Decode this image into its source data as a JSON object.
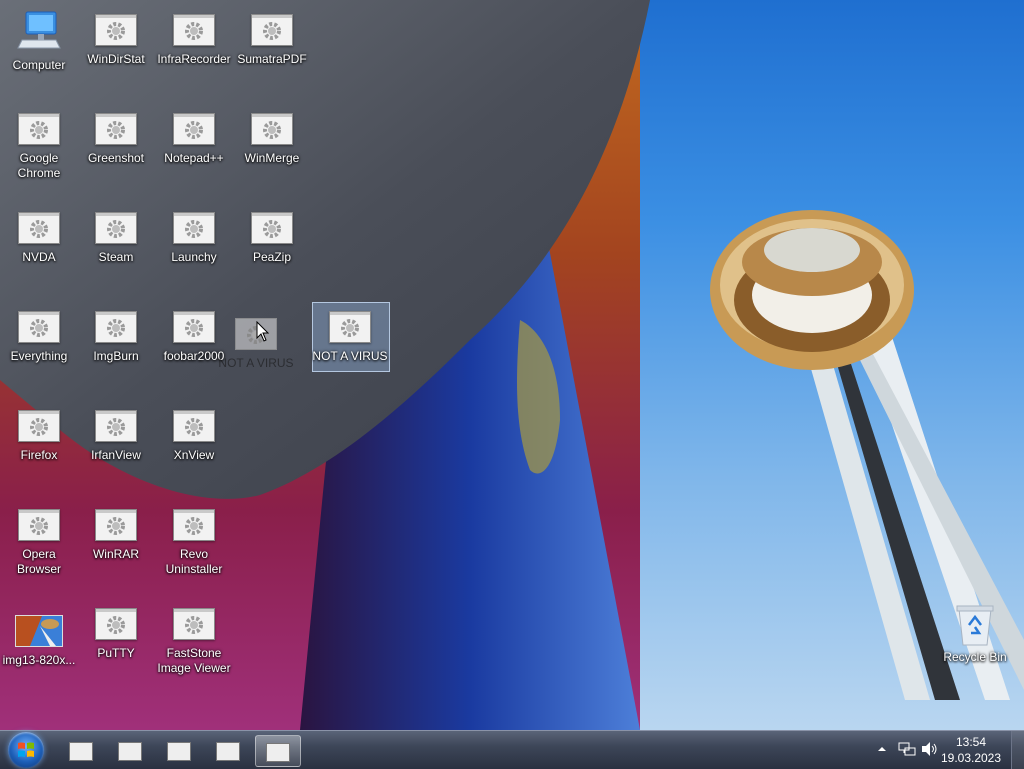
{
  "desktop": {
    "icons": [
      {
        "label": "Computer"
      },
      {
        "label": "WinDirStat"
      },
      {
        "label": "InfraRecorder"
      },
      {
        "label": "SumatraPDF"
      },
      {
        "label": "Google Chrome"
      },
      {
        "label": "Greenshot"
      },
      {
        "label": "Notepad++"
      },
      {
        "label": "WinMerge"
      },
      {
        "label": "NVDA"
      },
      {
        "label": "Steam"
      },
      {
        "label": "Launchy"
      },
      {
        "label": "PeaZip"
      },
      {
        "label": "Everything"
      },
      {
        "label": "ImgBurn"
      },
      {
        "label": "foobar2000"
      },
      {
        "label": "NOT A VIRUS"
      },
      {
        "label": "Firefox"
      },
      {
        "label": "IrfanView"
      },
      {
        "label": "XnView"
      },
      {
        "label": "Opera Browser"
      },
      {
        "label": "WinRAR"
      },
      {
        "label": "Revo Uninstaller"
      },
      {
        "label": "img13-820x..."
      },
      {
        "label": "PuTTY"
      },
      {
        "label": "FastStone Image Viewer"
      },
      {
        "label": "Recycle Bin"
      }
    ],
    "drag_ghost_label": "NOT A VIRUS"
  },
  "taskbar": {
    "clock_time": "13:54",
    "clock_date": "19.03.2023"
  },
  "colors": {
    "taskbar": "#3d4658",
    "selection": "#8caad2"
  }
}
